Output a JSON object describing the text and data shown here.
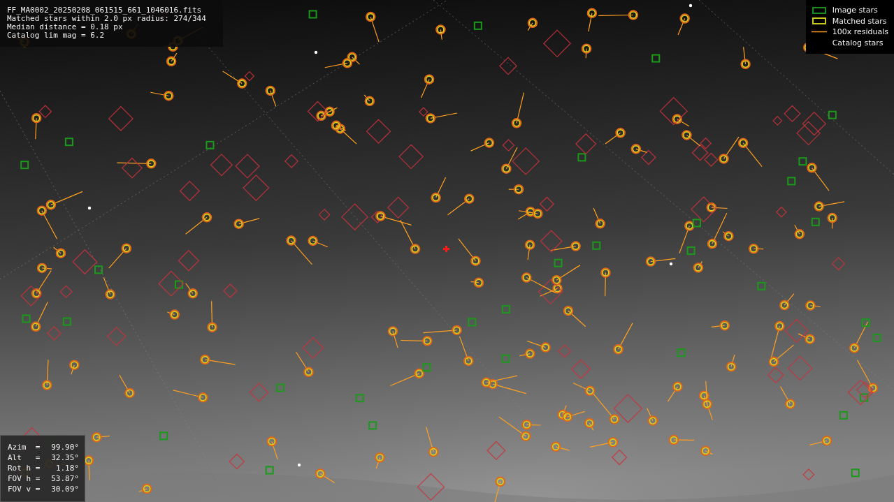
{
  "info": [
    "FF_MA0002_20250208_061515_661_1046016.fits",
    "Matched stars within 2.0 px radius: 274/344",
    "Median distance = 0.18 px",
    "Catalog lim mag = 6.2"
  ],
  "legend": [
    {
      "label": "Image stars",
      "kind": "box",
      "color": "#1a8c1a"
    },
    {
      "label": "Matched stars",
      "kind": "box",
      "color": "#c8c81e"
    },
    {
      "label": "100x residuals",
      "kind": "line",
      "color": "#ff9a1e"
    },
    {
      "label": "Catalog stars",
      "kind": "none"
    }
  ],
  "pointing": [
    {
      "label": "Azim  =",
      "value": "99.90°"
    },
    {
      "label": "Alt   =",
      "value": "32.35°"
    },
    {
      "label": "Rot h =",
      "value": "1.18°"
    },
    {
      "label": "FOV h =",
      "value": "53.87°"
    },
    {
      "label": "FOV v =",
      "value": "30.09°"
    }
  ]
}
